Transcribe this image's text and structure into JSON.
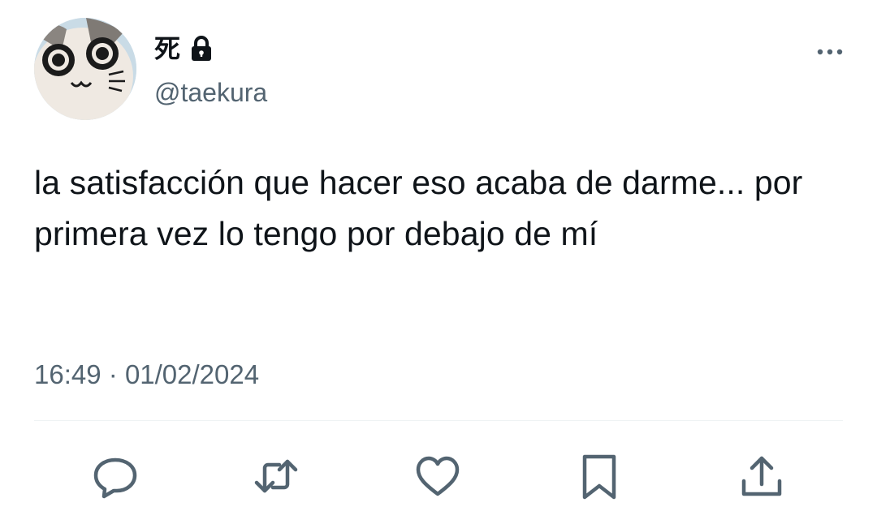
{
  "user": {
    "display_name": "死",
    "handle": "@taekura",
    "protected": true
  },
  "tweet": {
    "text": "la satisfacción que hacer eso acaba de darme... por primera vez lo tengo por debajo de mí",
    "time": "16:49",
    "separator": "·",
    "date": "01/02/2024"
  },
  "icons": {
    "more": "more-horizontal-icon",
    "reply": "reply-icon",
    "retweet": "retweet-icon",
    "like": "heart-icon",
    "bookmark": "bookmark-icon",
    "share": "share-icon",
    "lock": "lock-icon"
  },
  "colors": {
    "text": "#0f1419",
    "secondary": "#536471",
    "divider": "#eff3f4"
  }
}
